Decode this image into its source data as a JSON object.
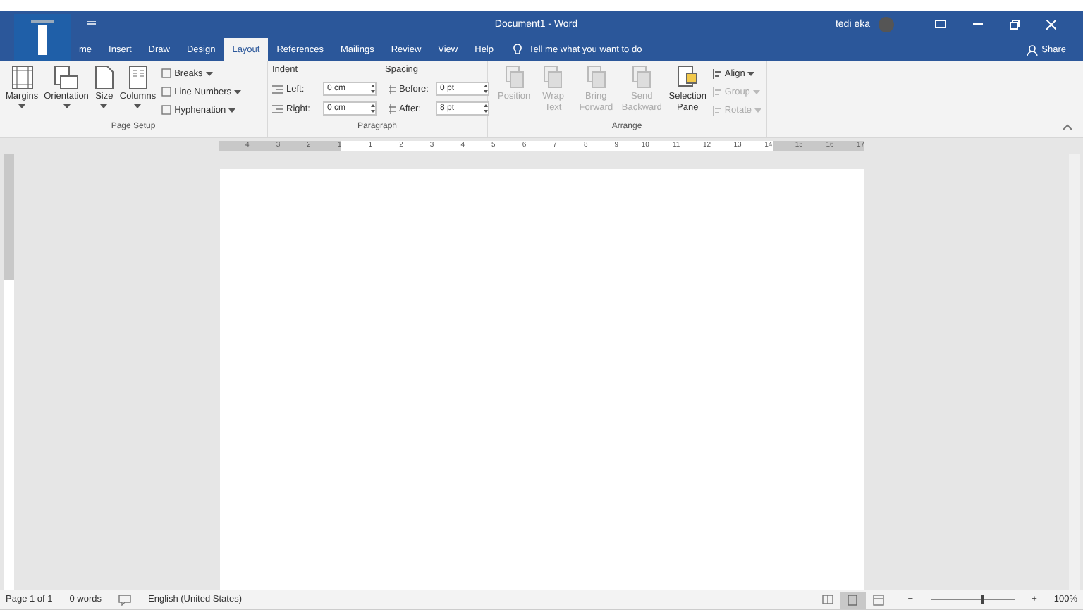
{
  "title_bar": {
    "title": "Document1 - Word",
    "user": "tedi eka"
  },
  "tabs": [
    {
      "label": "me",
      "selected": false
    },
    {
      "label": "Insert",
      "selected": false
    },
    {
      "label": "Draw",
      "selected": false
    },
    {
      "label": "Design",
      "selected": false
    },
    {
      "label": "Layout",
      "selected": true
    },
    {
      "label": "References",
      "selected": false
    },
    {
      "label": "Mailings",
      "selected": false
    },
    {
      "label": "Review",
      "selected": false
    },
    {
      "label": "View",
      "selected": false
    },
    {
      "label": "Help",
      "selected": false
    }
  ],
  "tell_me": "Tell me what you want to do",
  "share": "Share",
  "page_setup": {
    "label": "Page Setup",
    "large": [
      {
        "label": "Margins",
        "kind": "margins"
      },
      {
        "label": "Orientation",
        "kind": "orientation"
      },
      {
        "label": "Size",
        "kind": "size"
      },
      {
        "label": "Columns",
        "kind": "columns"
      }
    ],
    "small": [
      {
        "label": "Breaks"
      },
      {
        "label": "Line Numbers"
      },
      {
        "label": "Hyphenation"
      }
    ]
  },
  "paragraph": {
    "label": "Paragraph",
    "indent_title": "Indent",
    "spacing_title": "Spacing",
    "indent": [
      {
        "label": "Left:",
        "value": "0 cm"
      },
      {
        "label": "Right:",
        "value": "0 cm"
      }
    ],
    "spacing": [
      {
        "label": "Before:",
        "value": "0 pt"
      },
      {
        "label": "After:",
        "value": "8 pt"
      }
    ]
  },
  "arrange": {
    "label": "Arrange",
    "large": [
      {
        "label": "Position",
        "disabled": true
      },
      {
        "label": "Wrap Text",
        "disabled": true
      },
      {
        "label": "Bring Forward",
        "disabled": true
      },
      {
        "label": "Send Backward",
        "disabled": true
      },
      {
        "label": "Selection Pane",
        "disabled": false
      }
    ],
    "small": [
      {
        "label": "Align",
        "disabled": false
      },
      {
        "label": "Group",
        "disabled": true
      },
      {
        "label": "Rotate",
        "disabled": true
      }
    ]
  },
  "ruler": [
    {
      "label": "4",
      "margin": true
    },
    {
      "label": "3",
      "margin": true
    },
    {
      "label": "2",
      "margin": true
    },
    {
      "label": "1",
      "margin": true
    },
    {
      "label": "1",
      "margin": false
    },
    {
      "label": "2",
      "margin": false
    },
    {
      "label": "3",
      "margin": false
    },
    {
      "label": "4",
      "margin": false
    },
    {
      "label": "5",
      "margin": false
    },
    {
      "label": "6",
      "margin": false
    },
    {
      "label": "7",
      "margin": false
    },
    {
      "label": "8",
      "margin": false
    },
    {
      "label": "9",
      "margin": false
    },
    {
      "label": "10",
      "margin": false
    },
    {
      "label": "11",
      "margin": false
    },
    {
      "label": "12",
      "margin": false
    },
    {
      "label": "13",
      "margin": false
    },
    {
      "label": "14",
      "margin": false
    },
    {
      "label": "15",
      "margin": true
    },
    {
      "label": "16",
      "margin": true
    },
    {
      "label": "17",
      "margin": true
    }
  ],
  "status_bar": {
    "page": "Page 1 of 1",
    "words": "0 words",
    "language": "English (United States)",
    "views": [
      {
        "kind": "read",
        "selected": false
      },
      {
        "kind": "print",
        "selected": true
      },
      {
        "kind": "web",
        "selected": false
      }
    ],
    "zoom": {
      "level": 0.6,
      "minus": "−",
      "plus": "+",
      "reading": "100%"
    }
  }
}
